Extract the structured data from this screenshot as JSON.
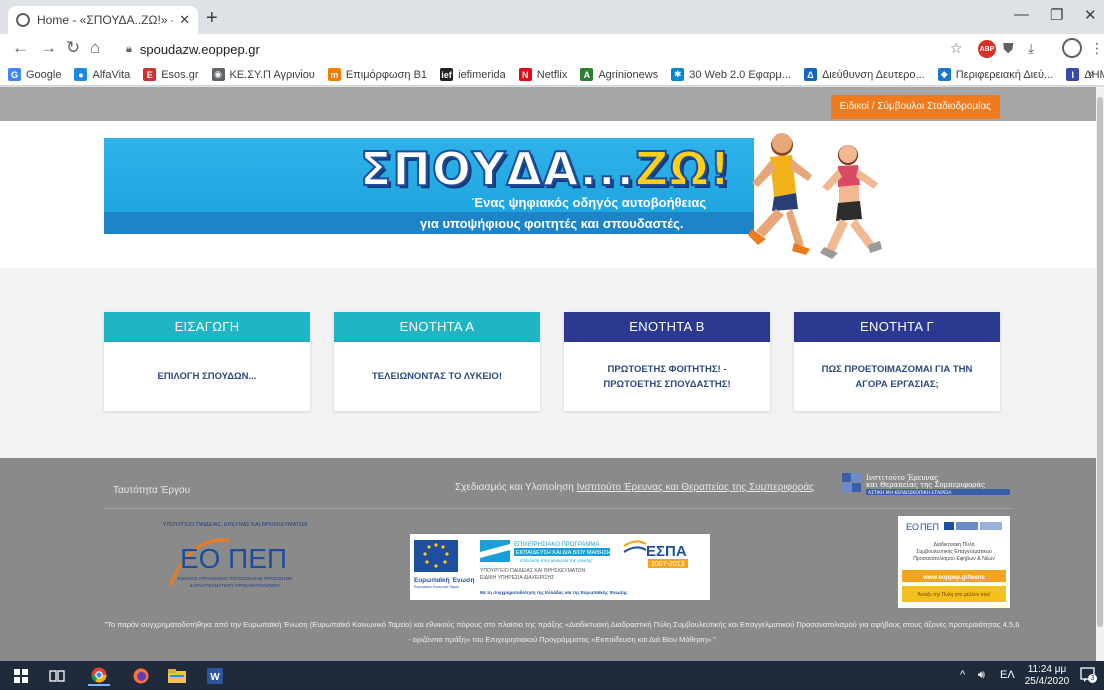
{
  "browser": {
    "tab_title": "Home - «ΣΠΟΥΔΑ..ΖΩ!» - Ένας ψ",
    "tab_close": "✕",
    "new_tab": "+",
    "url": "spoudazw.eoppep.gr",
    "window_controls": [
      "—",
      "❐",
      "✕"
    ]
  },
  "bookmarks": [
    {
      "label": "Google",
      "icon": "google-icon",
      "color": "#4285f4",
      "glyph": "G"
    },
    {
      "label": "AlfaVita",
      "icon": "alfavita-icon",
      "color": "#1e88e5",
      "glyph": "●"
    },
    {
      "label": "Esos.gr",
      "icon": "esos-icon",
      "color": "#d32f2f",
      "glyph": "E"
    },
    {
      "label": "ΚΕ.ΣΥ.Π Αγρινίου",
      "icon": "globe-icon",
      "color": "#5f6368",
      "glyph": "◉"
    },
    {
      "label": "Επιμόρφωση Β1",
      "icon": "moodle-icon",
      "color": "#f57c00",
      "glyph": "m"
    },
    {
      "label": "iefimerida",
      "icon": "iefimerida-icon",
      "color": "#222222",
      "glyph": "ief"
    },
    {
      "label": "Netflix",
      "icon": "netflix-icon",
      "color": "#e50914",
      "glyph": "N"
    },
    {
      "label": "Agrinionews",
      "icon": "agrinionews-icon",
      "color": "#2e7d32",
      "glyph": "A"
    },
    {
      "label": "30 Web 2.0 Εφαρμ...",
      "icon": "web20-icon",
      "color": "#0288d1",
      "glyph": "✱"
    },
    {
      "label": "Διεύθυνση Δευτερο...",
      "icon": "school-icon",
      "color": "#1565c0",
      "glyph": "Δ"
    },
    {
      "label": "Περιφερειακή Διεύ...",
      "icon": "region-icon",
      "color": "#1976d2",
      "glyph": "◆"
    },
    {
      "label": "ΔΗΜΟΣΙΑ ΙΕΚ",
      "icon": "iek-icon",
      "color": "#3949ab",
      "glyph": "Ι"
    }
  ],
  "bookmarks_more": "»",
  "page": {
    "counsel_button": "Ειδικοί / Σύμβουλοι Σταδιοδρομίας",
    "logo": {
      "word": "ΣΠΟΥΔΑ...",
      "word_accent": "ΖΩ!"
    },
    "tagline_1": "Ένας ψηφιακός οδηγός αυτοβοήθειας",
    "tagline_2": "για υποψήφιους φοιτητές και σπουδαστές.",
    "cards": [
      {
        "title": "ΕΙΣΑΓΩΓΗ",
        "body": "ΕΠΙΛΟΓΗ ΣΠΟΥΔΩΝ...",
        "color": "#1fb5c4"
      },
      {
        "title": "ΕΝΟΤΗΤΑ Α",
        "body": "ΤΕΛΕΙΩΝΟΝΤΑΣ ΤΟ ΛΥΚΕΙΟ!",
        "color": "#1fb5c4"
      },
      {
        "title": "ΕΝΟΤΗΤΑ Β",
        "body": "ΠΡΩΤΟΕΤΗΣ ΦΟΙΤΗΤΗΣ! - ΠΡΩΤΟΕΤΗΣ ΣΠΟΥΔΑΣΤΗΣ!",
        "color": "#2b3990"
      },
      {
        "title": "ΕΝΟΤΗΤΑ Γ",
        "body": "ΠΩΣ ΠΡΟΕΤΟΙΜΑΖΟΜΑΙ ΓΙΑ ΤΗΝ ΑΓΟΡΑ ΕΡΓΑΣΙΑΣ;",
        "color": "#2b3990"
      }
    ]
  },
  "footer": {
    "identity": "Ταυτότητα Έργου",
    "credit_prefix": "Σχεδιασμός και Υλοποίηση",
    "credit_link": "Ινστιτούτο Έρευνας και Θεραπείας της Συμπεριφοράς",
    "institute_logo_l1": "Ινστιτούτο Έρευνας",
    "institute_logo_l2": "και Θεραπείας της Συμπεριφοράς",
    "institute_logo_l3": "ΑΣΤΙΚΗ ΜΗ ΚΕΡΔΟΣΚΟΠΙΚΗ ΕΤΑΙΡΕΙΑ",
    "eopep_top": "ΥΠΟΥΡΓΕΙΟ ΠΑΙΔΕΙΑΣ, ΕΡΕΥΝΑΣ ΚΑΙ ΘΡΗΣΚΕΥΜΑΤΩΝ",
    "eopep_word_a": "ΕΟ",
    "eopep_word_b": "ΠΕΠ",
    "eopep_sub1": "ΕΘΝΙΚΟΣ ΟΡΓΑΝΙΣΜΟΣ ΠΙΣΤΟΠΟΙΗΣΗΣ ΠΡΟΣΟΝΤΩΝ",
    "eopep_sub2": "& ΕΠΑΓΓΕΛΜΑΤΙΚΟΥ ΠΡΟΣΑΝΑΤΟΛΙΣΜΟΥ",
    "espa_eu": "Ευρωπαϊκή Ένωση",
    "espa_eu_sub": "Ευρωπαϊκό Κοινωνικό Ταμείο",
    "espa_program_1": "ΕΠΙΧΕΙΡΗΣΙΑΚΟ ΠΡΟΓΡΑΜΜΑ",
    "espa_program_2": "ΕΚΠΑΙΔΕΥΣΗ ΚΑΙ ΔΙΑ ΒΙΟΥ ΜΑΘΗΣΗ",
    "espa_program_3": "επένδυση στην κοινωνία της γνώσης",
    "espa_ministry": "ΥΠΟΥΡΓΕΙΟ ΠΑΙΔΕΙΑΣ ΚΑΙ ΘΡΗΣΚΕΥΜΑΤΩΝ",
    "espa_service": "ΕΙΔΙΚΗ ΥΠΗΡΕΣΙΑ ΔΙΑΧΕΙΡΙΣΗΣ",
    "espa_word": "ΕΣΠΑ",
    "espa_years": "2007-2013",
    "espa_cofund": "Με τη συγχρηματοδότηση της Ελλάδας και της Ευρωπαϊκής Ένωσης",
    "teens_l1": "Διαδικτυακή Πύλη",
    "teens_l2": "Συμβουλευτικής Επαγγελματικού",
    "teens_l3": "Προσανατολισμού Εφήβων & Νέων",
    "teens_url": "www.eoppep.gr/teens",
    "teens_slogan": "Άνοιξε την Πύλη στο μέλλον σου!",
    "note": "\"Το παρόν συγχρηματοδοτήθηκε από την Ευρωπαϊκή Ένωση (Ευρωπαϊκό Κοινωνικό Ταμείο) και εθνικούς πόρους στο πλαίσιο της πράξης «Διαδικτυακή Διαδραστική Πύλη Συμβουλευτικής και Επαγγελματικού Προσανατολισμού για σφήβους στους άξονες προτεραιότητας 4,5,6 - οριζόντια πράξη» του Επιχειρησιακού Προγράμματος «Εκπαίδευση και Διά Βίου Μάθηση».\""
  },
  "taskbar": {
    "lang": "ΕΛ",
    "time": "11:24 μμ",
    "date": "25/4/2020",
    "notifications": "3"
  },
  "colors": {
    "accent_orange": "#f07a1e",
    "teal": "#1fb5c4",
    "navy": "#2b3990",
    "footer_gray": "#8a8a8a"
  }
}
